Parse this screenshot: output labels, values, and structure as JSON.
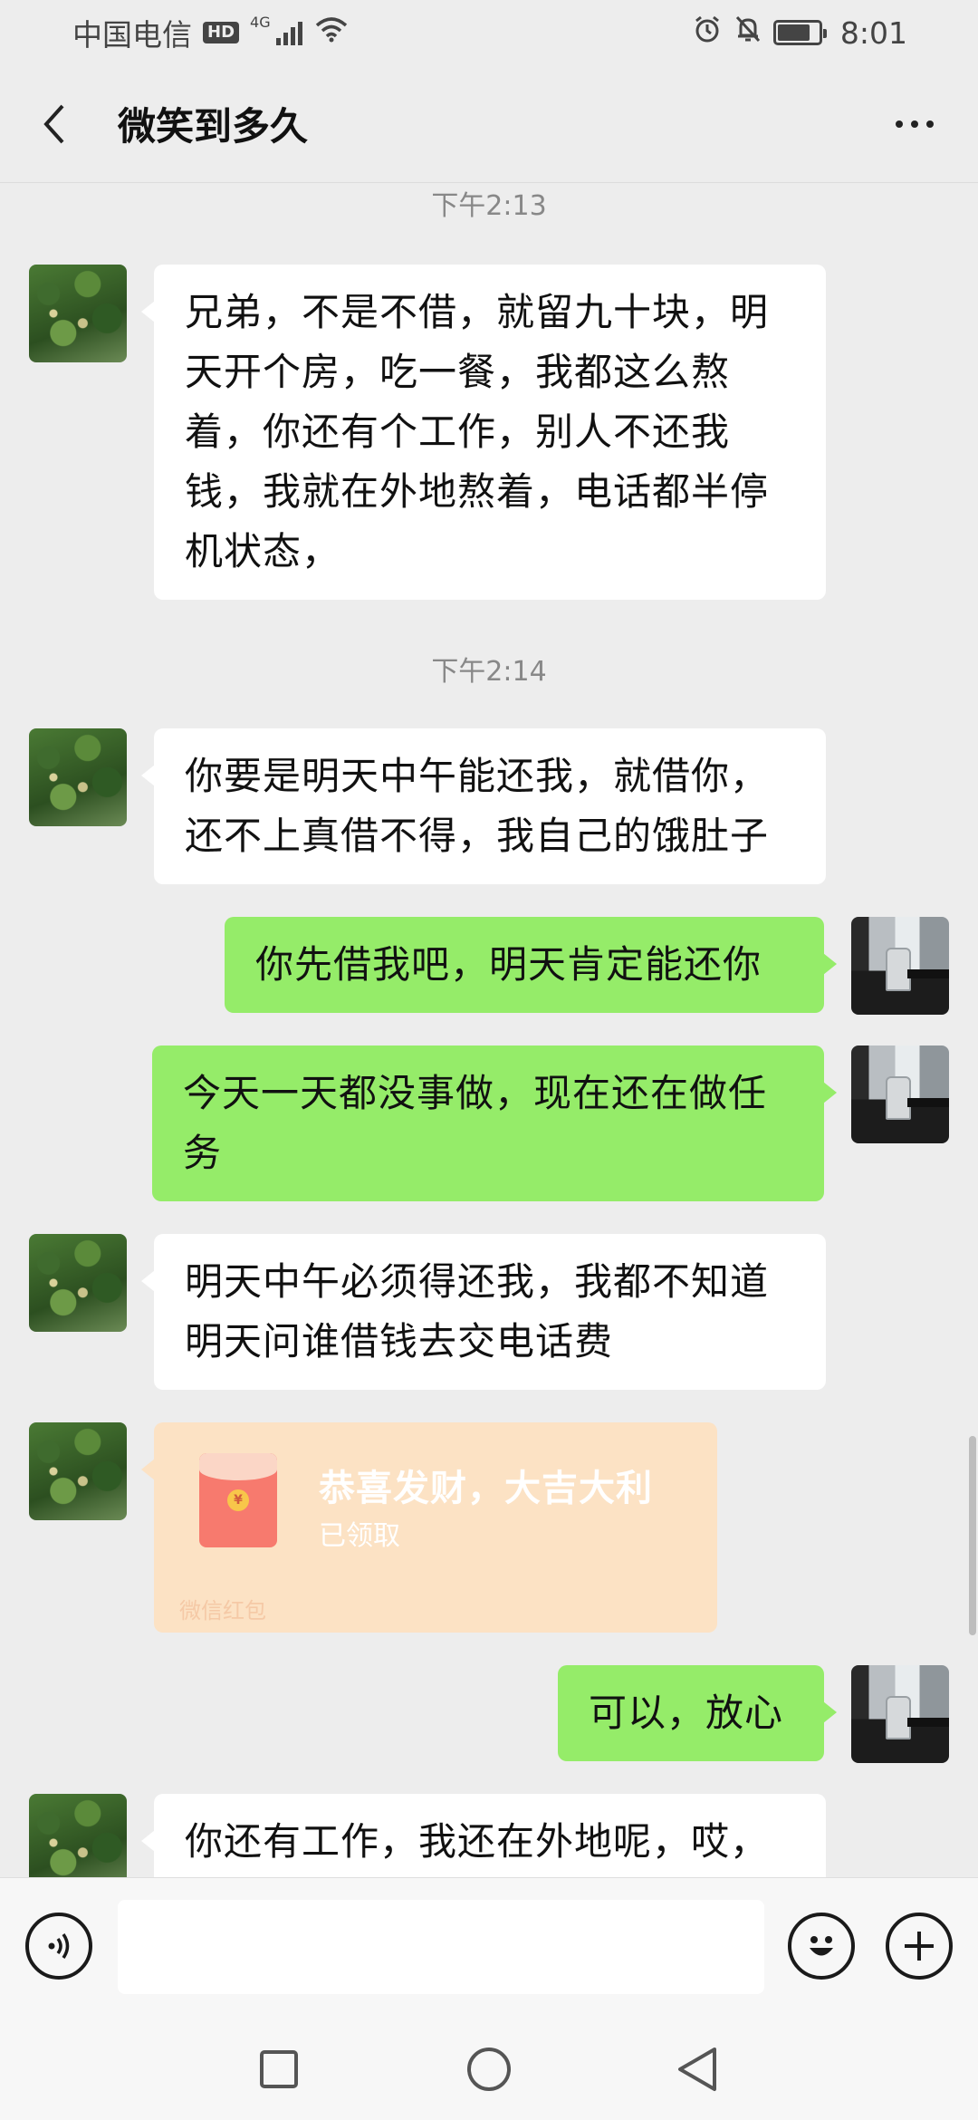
{
  "status_bar": {
    "carrier": "中国电信",
    "hd_badge": "HD",
    "network_type": "4G",
    "time": "8:01",
    "battery_level": 0.8
  },
  "header": {
    "title": "微笑到多久",
    "back_icon": "chevron-left-icon",
    "more_icon": "more-dots-icon"
  },
  "chat": {
    "time_1": "下午2:13",
    "time_2": "下午2:14",
    "messages": [
      {
        "side": "left",
        "text": "兄弟，不是不借，就留九十块，明天开个房，吃一餐，我都这么熬着，你还有个工作，别人不还我钱，我就在外地熬着，电话都半停机状态，"
      },
      {
        "side": "left",
        "text": "你要是明天中午能还我，就借你，还不上真借不得，我自己的饿肚子"
      },
      {
        "side": "right",
        "text": "你先借我吧，明天肯定能还你"
      },
      {
        "side": "right",
        "text": "今天一天都没事做，现在还在做任务"
      },
      {
        "side": "left",
        "text": "明天中午必须得还我，我都不知道明天问谁借钱去交电话费"
      },
      {
        "side": "right",
        "text": "可以，放心"
      },
      {
        "side": "left",
        "text": "你还有工作，我还在外地呢，哎，"
      }
    ],
    "red_packet": {
      "title": "恭喜发财，大吉大利",
      "status": "已领取",
      "footer": "微信红包",
      "coin_symbol": "¥"
    }
  },
  "input_bar": {
    "placeholder": "",
    "voice_icon": "voice-icon",
    "emoji_icon": "emoji-icon",
    "plus_icon": "plus-icon"
  },
  "colors": {
    "background": "#ededed",
    "bubble_left": "#ffffff",
    "bubble_right": "#95ec69",
    "red_packet_bg": "#fce2c4"
  }
}
